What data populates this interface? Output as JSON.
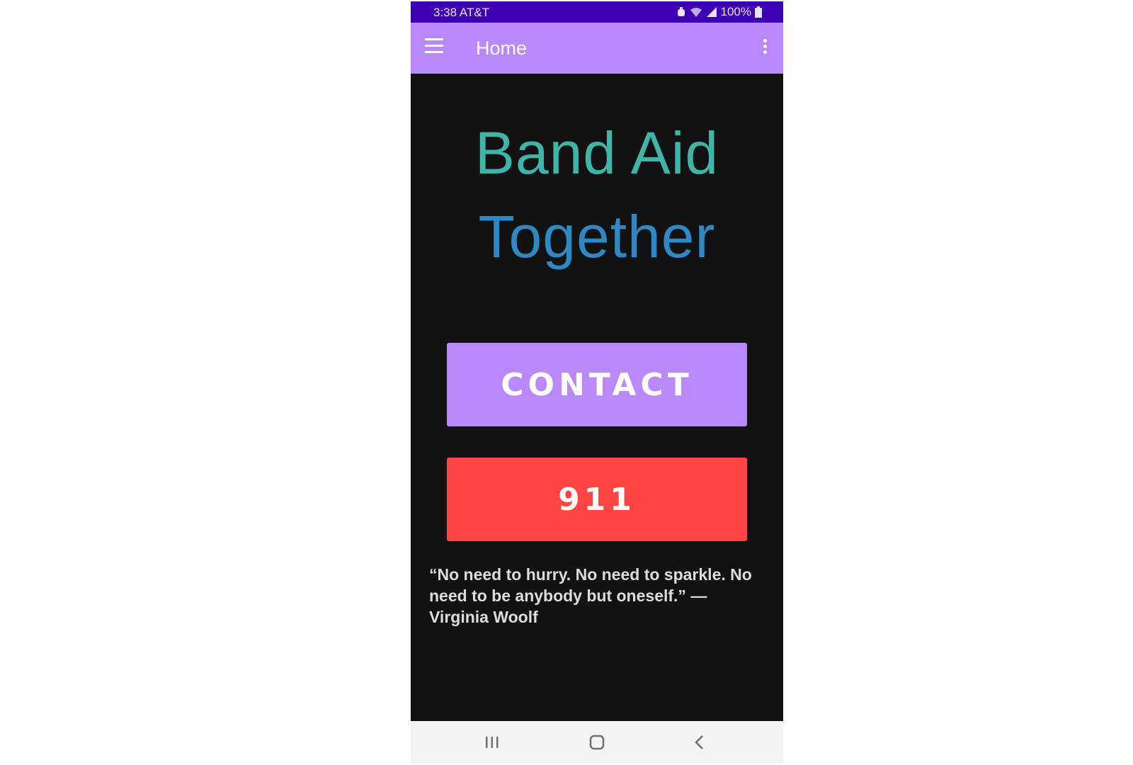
{
  "status_bar": {
    "time_carrier": "3:38 AT&T",
    "battery": "100%",
    "icons": [
      "alarm-icon",
      "wifi-icon",
      "signal-icon",
      "battery-icon"
    ]
  },
  "app_bar": {
    "title": "Home",
    "menu_icon": "menu-icon",
    "overflow_icon": "more-vertical-icon"
  },
  "hero": {
    "line1": "Band Aid",
    "line2": "Together"
  },
  "buttons": {
    "contact_label": "CONTACT",
    "emergency_label": "911"
  },
  "quote": {
    "text": "“No need to hurry. No need to sparkle. No need to be anybody but oneself.” — Virginia Woolf"
  },
  "nav_bar": {
    "icons": [
      "recents-icon",
      "home-icon",
      "back-icon"
    ]
  },
  "colors": {
    "status_bar": "#3e00b3",
    "app_bar": "#b988fa",
    "background": "#121212",
    "hero_line1": "#3fb5a8",
    "hero_line2": "#2d88c4",
    "contact_button": "#b988fa",
    "emergency_button": "#ff4444"
  }
}
